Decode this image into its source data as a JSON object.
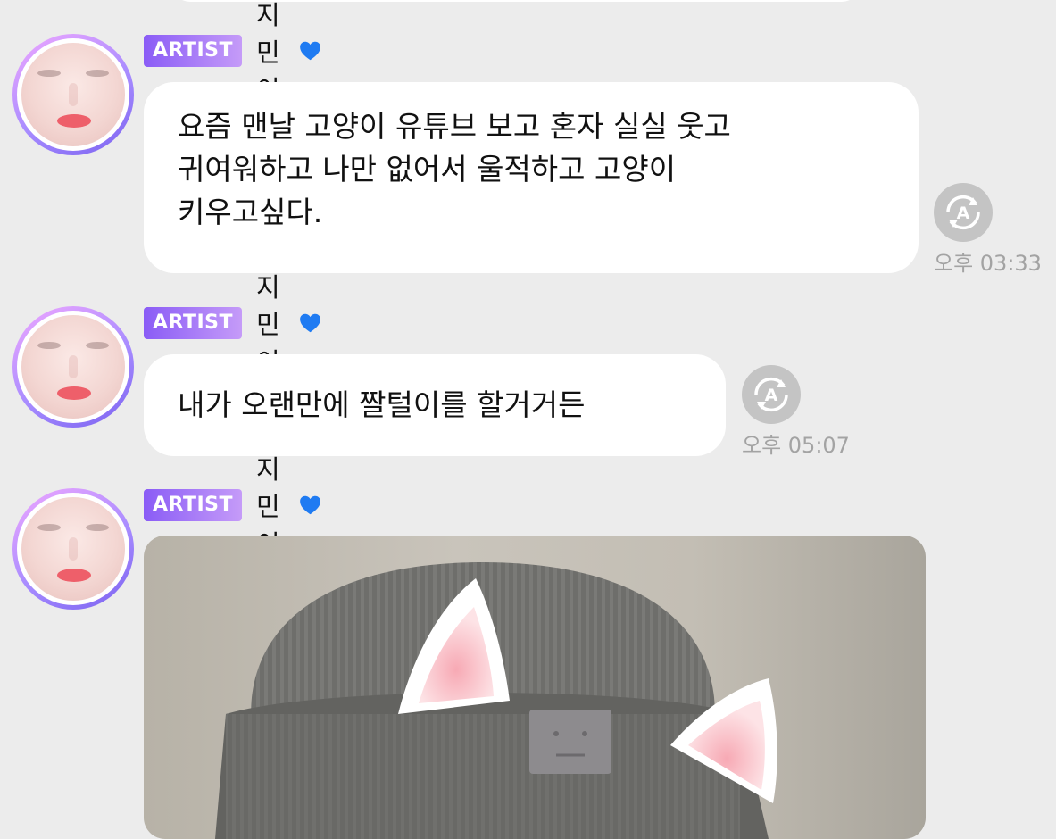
{
  "messages": [
    {
      "badge": "ARTIST",
      "sender": "지민이",
      "lines": [
        "요즘 맨날 고양이 유튜브 보고 혼자 실실 웃고",
        "귀여워하고 나만 없어서 울적하고 고양이",
        "키우고싶다."
      ],
      "time": "오후 03:33"
    },
    {
      "badge": "ARTIST",
      "sender": "지민이",
      "lines": [
        "내가 오랜만에 짤털이를 할거거든"
      ],
      "time": "오후 05:07"
    },
    {
      "badge": "ARTIST",
      "sender": "지민이",
      "image": "photo-cat-ear-beanie"
    }
  ],
  "icons": {
    "heart": "blue-heart-icon",
    "translate": "translate-icon"
  },
  "colors": {
    "background": "#ececec",
    "badge_start": "#8a5cf6",
    "badge_end": "#c59bf8",
    "heart": "#1f7bf2",
    "time": "#a3a3a3"
  }
}
